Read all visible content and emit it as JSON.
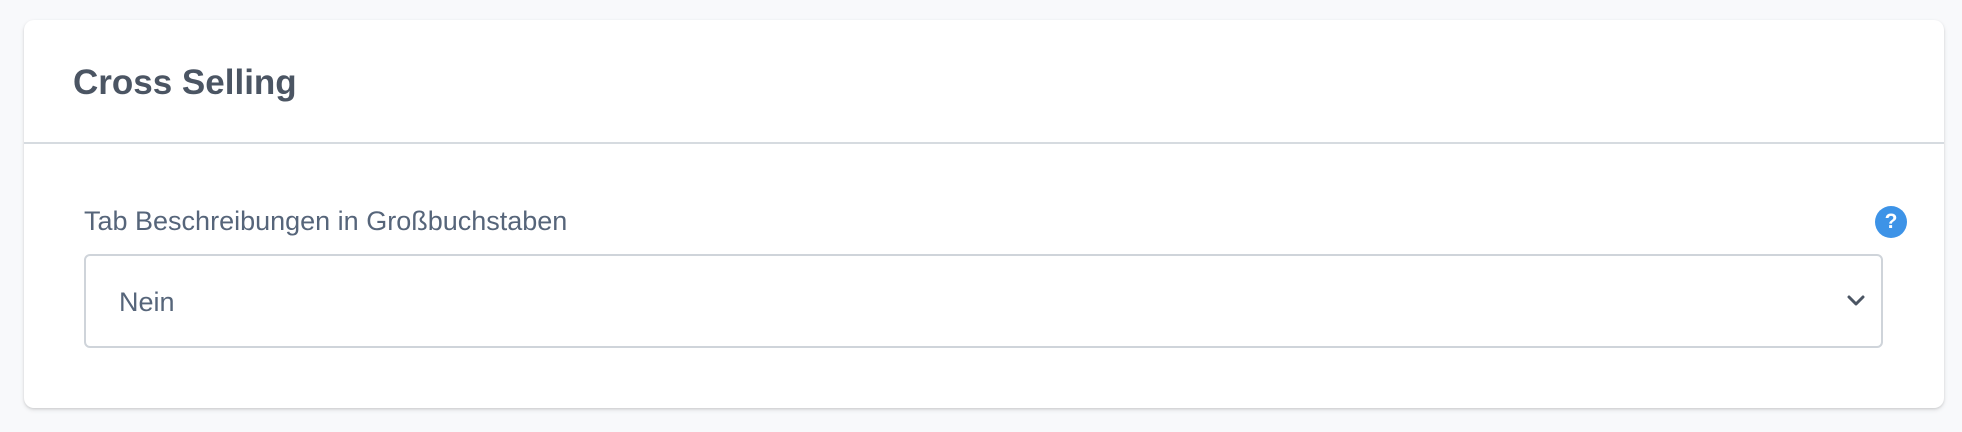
{
  "card": {
    "title": "Cross Selling"
  },
  "field": {
    "label": "Tab Beschreibungen in Großbuchstaben",
    "help_glyph": "?",
    "select": {
      "value": "Nein",
      "icon": "chevron-down-icon"
    }
  },
  "colors": {
    "accent": "#3d93e7",
    "text": "#56657a",
    "title": "#4b5563",
    "border": "#cfd4da",
    "background": "#f8f9fb"
  }
}
